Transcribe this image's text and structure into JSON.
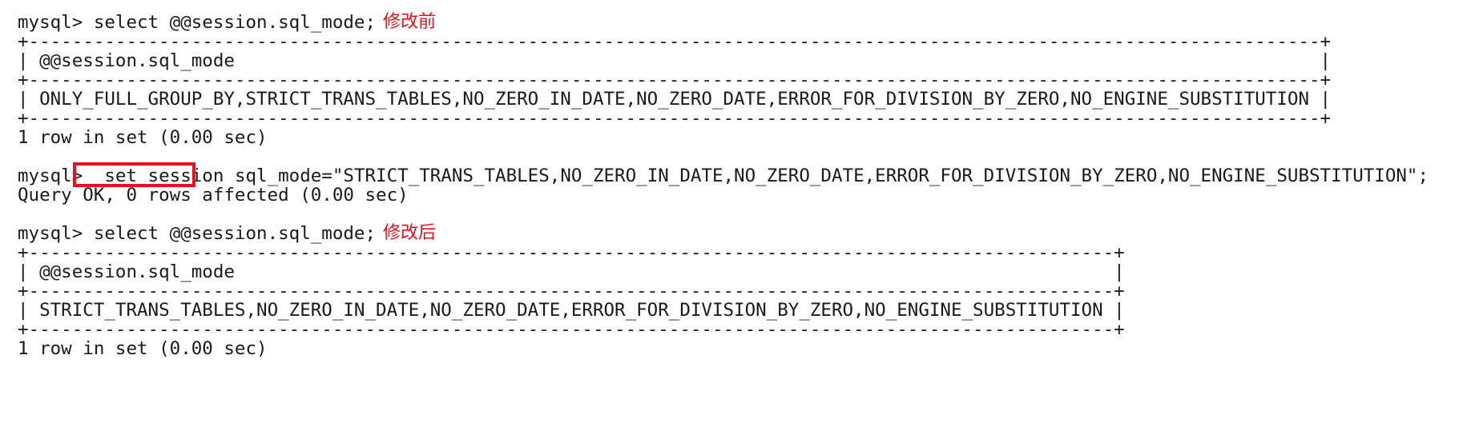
{
  "terminal": {
    "prompt": "mysql> ",
    "blocks": [
      {
        "command": "select @@session.sql_mode;",
        "annotation": "修改前",
        "table": {
          "header": "@@session.sql_mode",
          "value": "ONLY_FULL_GROUP_BY,STRICT_TRANS_TABLES,NO_ZERO_IN_DATE,NO_ZERO_DATE,ERROR_FOR_DIVISION_BY_ZERO,NO_ENGINE_SUBSTITUTION"
        },
        "result": "1 row in set (0.00 sec)"
      },
      {
        "command_highlight": " set session ",
        "command_rest": "sql_mode=\"STRICT_TRANS_TABLES,NO_ZERO_IN_DATE,NO_ZERO_DATE,ERROR_FOR_DIVISION_BY_ZERO,NO_ENGINE_SUBSTITUTION\";",
        "result": "Query OK, 0 rows affected (0.00 sec)"
      },
      {
        "command": "select @@session.sql_mode;",
        "annotation": "修改后",
        "table": {
          "header": "@@session.sql_mode",
          "value": "STRICT_TRANS_TABLES,NO_ZERO_IN_DATE,NO_ZERO_DATE,ERROR_FOR_DIVISION_BY_ZERO,NO_ENGINE_SUBSTITUTION"
        },
        "result": "1 row in set (0.00 sec)"
      }
    ]
  },
  "colors": {
    "annotation": "#e8111b",
    "highlight_border": "#e8111b",
    "text": "#1a1a1a",
    "background": "#ffffff"
  }
}
